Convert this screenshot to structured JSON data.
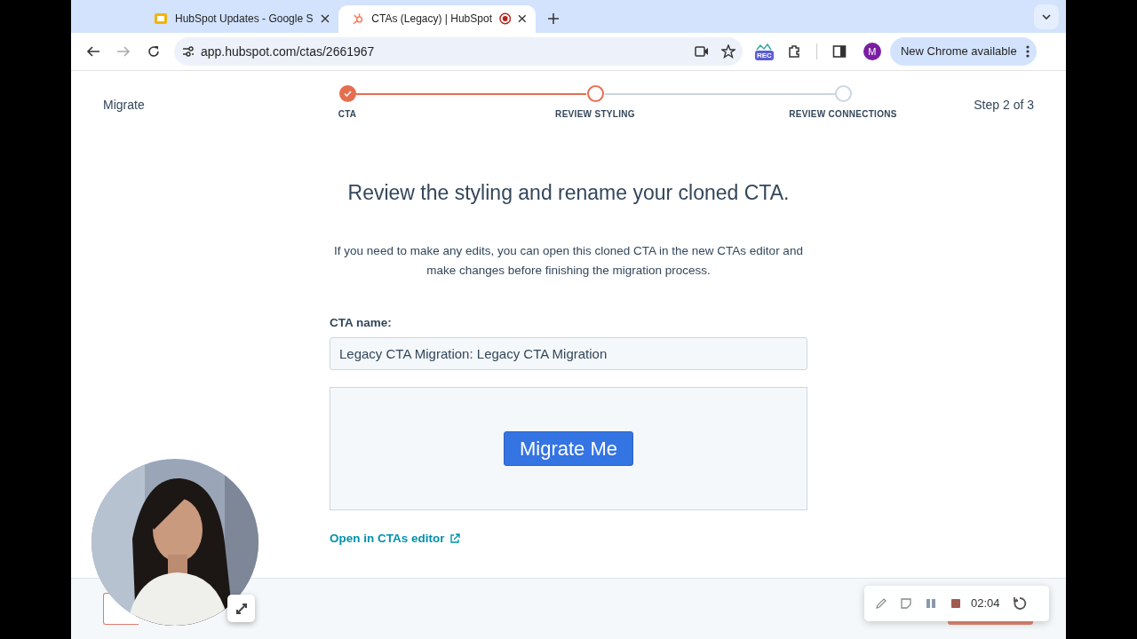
{
  "browser": {
    "tabs": [
      {
        "title": "HubSpot Updates - Google S",
        "kind": "slides",
        "selected": false,
        "recording": false
      },
      {
        "title": "CTAs (Legacy) | HubSpot",
        "kind": "hubspot",
        "selected": true,
        "recording": true
      }
    ],
    "url": "app.hubspot.com/ctas/2661967",
    "forward_disabled": true,
    "rec_badge": "REC",
    "profile_initial": "M",
    "update_label": "New Chrome available"
  },
  "stepper": {
    "title": "Migrate",
    "steps": [
      {
        "label": "CTA",
        "completed": true,
        "selected": false
      },
      {
        "label": "REVIEW STYLING",
        "completed": false,
        "selected": true
      },
      {
        "label": "REVIEW CONNECTIONS",
        "completed": false,
        "selected": false
      }
    ],
    "counter": "Step 2 of 3"
  },
  "content": {
    "heading": "Review the styling and rename your cloned CTA.",
    "description": "If you need to make any edits, you can open this cloned CTA in the new CTAs editor and make changes before finishing the migration process.",
    "name_label": "CTA name:",
    "name_value": "Legacy CTA Migration: Legacy CTA Migration",
    "preview_button": "Migrate Me",
    "editor_link": "Open in CTAs editor"
  },
  "footer": {
    "buttons": [
      {
        "kind": "secondary"
      },
      {
        "kind": "primary"
      }
    ]
  },
  "recorder": {
    "time": "02:04"
  }
}
